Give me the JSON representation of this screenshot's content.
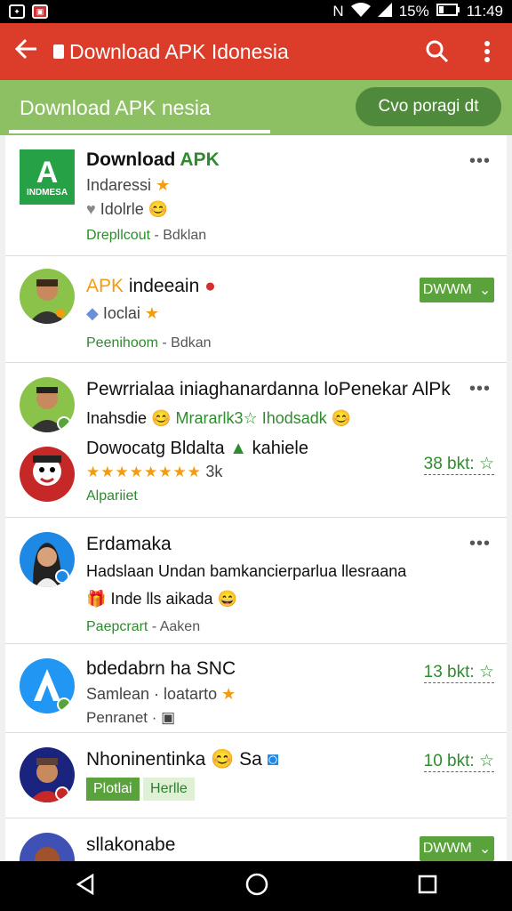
{
  "status_bar": {
    "time": "11:49",
    "battery": "15%"
  },
  "app_bar": {
    "title": "Download APK Idonesia"
  },
  "sub_bar": {
    "title": "Download APK nesia",
    "button": "Cvo poragi dt"
  },
  "items": [
    {
      "title_a": "Download ",
      "title_b": "APK",
      "line2": "Indaressi",
      "line3": "Idolrle",
      "line4_a": "Drepllcout",
      "line4_b": "- Bdklan"
    },
    {
      "title_a": "APK",
      "title_b": " indeeain",
      "line2": "Ioclai",
      "line4_a": "Peenihoom",
      "line4_b": "- Bdkan",
      "button": "DWWM"
    },
    {
      "title": "Pewrrialaa iniaghanardanna loPenekar AlPk",
      "line2_a": "Inahsdie",
      "line2_b": "Mrararlk3",
      "line2_c": "Ihodsadk",
      "title2": "Dowocatg Bldalta",
      "title2_b": "kahiele",
      "rating": "★★★★★★★★",
      "rating_count": "3k",
      "line4": "Alpariiet",
      "size": "38 bkt:"
    },
    {
      "title": "Erdamaka",
      "line2": "Hadslaan Undan bamkancierparlua llesraana",
      "line3": "Inde lls aikada",
      "line4_a": "Paepcrart",
      "line4_b": "- Aaken"
    },
    {
      "title": "bdedabrn ha SNC",
      "line2": "Samlean · loatarto",
      "line4": "Penranet ·",
      "size": "13 bkt:"
    },
    {
      "title": "Nhoninentinka",
      "title_b": "Sa",
      "chip1": "Plotlai",
      "chip2": "Herlle",
      "size": "10 bkt:"
    },
    {
      "title": "sllakonabe",
      "button": "DWWM"
    }
  ],
  "colors": {
    "app_bar": "#dc3d2b",
    "sub_bar": "#8cc063",
    "accent_green": "#5aa23b"
  }
}
